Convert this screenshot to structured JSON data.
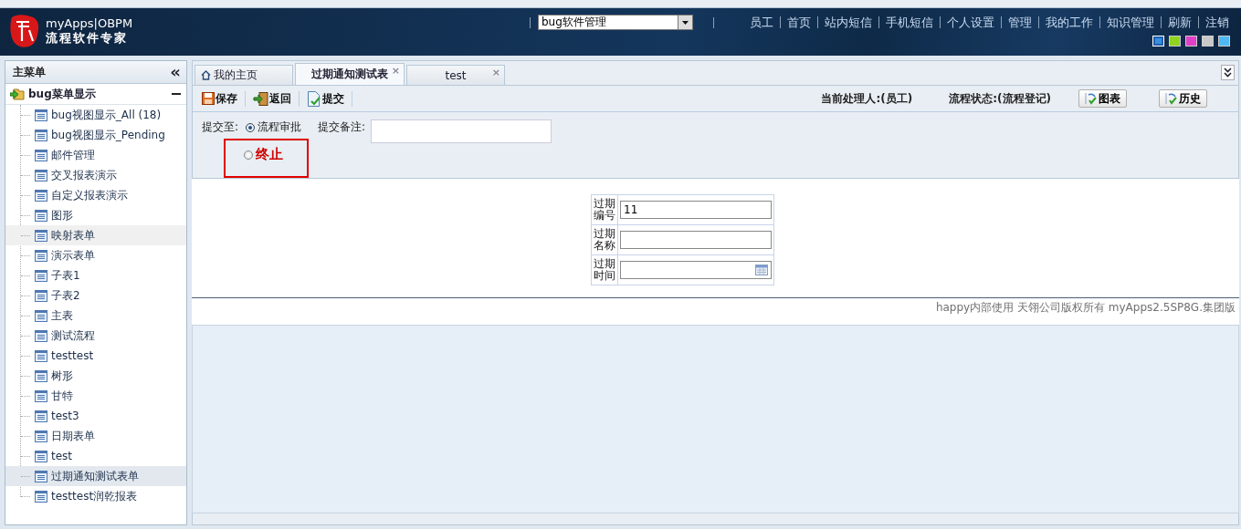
{
  "header": {
    "brand": "myApps|OBPM",
    "tagline": "流程软件专家",
    "app_select": {
      "value": "bug软件管理"
    },
    "nav_links": [
      "员工",
      "首页",
      "站内短信",
      "手机短信",
      "个人设置",
      "管理",
      "我的工作",
      "知识管理",
      "刷新",
      "注销"
    ],
    "theme_swatches": [
      {
        "color": "#3a8ee0",
        "selected": true
      },
      {
        "color": "#8ed420",
        "selected": false
      },
      {
        "color": "#e040c8",
        "selected": false
      },
      {
        "color": "#c8c8c8",
        "selected": false
      },
      {
        "color": "#50b8f0",
        "selected": false
      }
    ]
  },
  "sidebar": {
    "title": "主菜单",
    "collapse": "«",
    "group": {
      "label": "bug菜单显示",
      "expanded": true,
      "children": [
        {
          "label": "bug视图显示_All (18)",
          "selected": false,
          "hovered": false
        },
        {
          "label": "bug视图显示_Pending",
          "selected": false,
          "hovered": false
        },
        {
          "label": "邮件管理",
          "selected": false,
          "hovered": false
        },
        {
          "label": "交叉报表演示",
          "selected": false,
          "hovered": false
        },
        {
          "label": "自定义报表演示",
          "selected": false,
          "hovered": false
        },
        {
          "label": "图形",
          "selected": false,
          "hovered": false
        },
        {
          "label": "映射表单",
          "selected": false,
          "hovered": true
        },
        {
          "label": "演示表单",
          "selected": false,
          "hovered": false
        },
        {
          "label": "子表1",
          "selected": false,
          "hovered": false
        },
        {
          "label": "子表2",
          "selected": false,
          "hovered": false
        },
        {
          "label": "主表",
          "selected": false,
          "hovered": false
        },
        {
          "label": "测试流程",
          "selected": false,
          "hovered": false
        },
        {
          "label": "testtest",
          "selected": false,
          "hovered": false
        },
        {
          "label": "树形",
          "selected": false,
          "hovered": false
        },
        {
          "label": "甘特",
          "selected": false,
          "hovered": false
        },
        {
          "label": "test3",
          "selected": false,
          "hovered": false
        },
        {
          "label": "日期表单",
          "selected": false,
          "hovered": false
        },
        {
          "label": "test",
          "selected": false,
          "hovered": false
        },
        {
          "label": "过期通知测试表单",
          "selected": true,
          "hovered": false
        },
        {
          "label": "testtest润乾报表",
          "selected": false,
          "hovered": false
        }
      ]
    }
  },
  "tabs": [
    {
      "label": "我的主页",
      "kind": "home",
      "selected": false
    },
    {
      "label": "过期通知测试表",
      "kind": "form",
      "close": "×",
      "selected": true
    },
    {
      "label": "test",
      "kind": "form",
      "close": "×",
      "selected": false
    }
  ],
  "toolbar": {
    "buttons": [
      {
        "label": "保存",
        "kind": "save"
      },
      {
        "label": "返回",
        "kind": "back"
      },
      {
        "label": "提交",
        "kind": "submit"
      }
    ],
    "handler": "当前处理人:(员工)",
    "flow_state": "流程状态:(流程登记)",
    "right_buttons": [
      "图表",
      "历史"
    ]
  },
  "submit": {
    "label": "提交至:",
    "options": [
      {
        "label": "流程审批",
        "selected": true,
        "highlighted": false
      },
      {
        "label": "终止",
        "selected": false,
        "highlighted": true
      }
    ],
    "remark_label": "提交备注:"
  },
  "form": {
    "fields": [
      {
        "label": "过期编号",
        "value": "11",
        "kind": "text"
      },
      {
        "label": "过期名称",
        "kind": "text"
      },
      {
        "label": "过期时间",
        "kind": "date"
      }
    ]
  },
  "footer": "happy内部使用 天翎公司版权所有 myApps2.5SP8G.集团版"
}
